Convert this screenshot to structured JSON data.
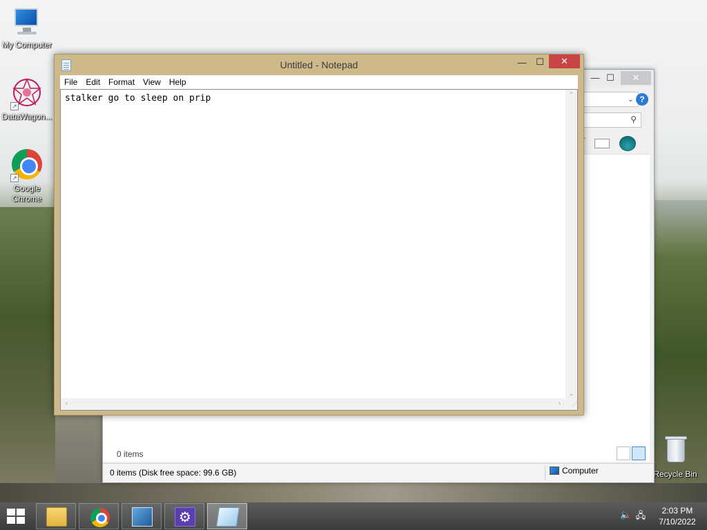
{
  "desktop": {
    "icons": [
      {
        "label": "My Computer",
        "icon": "computer-icon"
      },
      {
        "label": "DataWagon...",
        "icon": "datawagon-icon"
      },
      {
        "label": "Google Chrome",
        "icon": "chrome-icon"
      },
      {
        "label": "Recycle Bin",
        "icon": "recycle-bin-icon"
      }
    ]
  },
  "notepad": {
    "title": "Untitled - Notepad",
    "menu": [
      "File",
      "Edit",
      "Format",
      "View",
      "Help"
    ],
    "content": "stalker go to sleep on prip",
    "buttons": {
      "minimize": "—",
      "maximize": "☐",
      "close": "✕"
    }
  },
  "explorer": {
    "items_count": "0 items",
    "status_left": "0 items (Disk free space: 99.6 GB)",
    "status_right": "Computer",
    "help_label": "?",
    "buttons": {
      "minimize": "—",
      "maximize": "☐",
      "close": "✕"
    }
  },
  "taskbar": {
    "apps": [
      {
        "name": "File Explorer",
        "icon": "folder-icon"
      },
      {
        "name": "Google Chrome",
        "icon": "chrome-icon"
      },
      {
        "name": "Control Panel",
        "icon": "control-panel-icon"
      },
      {
        "name": "Settings",
        "icon": "gear-icon"
      },
      {
        "name": "Notepad",
        "icon": "notepad-icon",
        "active": true
      }
    ],
    "clock": {
      "time": "2:03 PM",
      "date": "7/10/2022"
    }
  },
  "colors": {
    "notepad_frame": "#cdb98a",
    "close_button": "#c74545",
    "taskbar": "#3a3c3a"
  }
}
